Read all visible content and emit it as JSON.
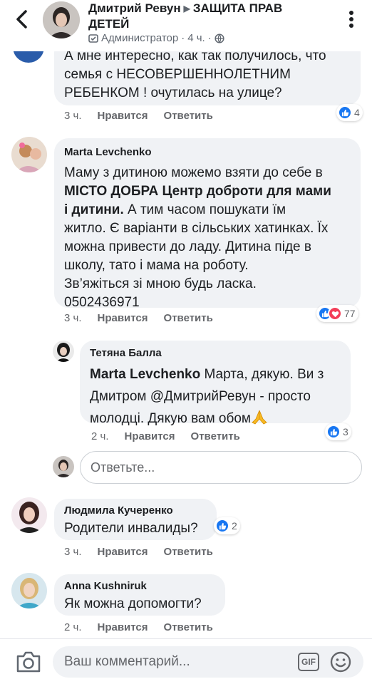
{
  "header": {
    "author": "Дмитрий Ревун",
    "group": "ЗАЩИТА ПРАВ ДЕТЕЙ",
    "role": "Администратор",
    "time": "4 ч.",
    "dot": "·"
  },
  "comments": [
    {
      "text_lines": [
        "А мне интересно, как так получилось, что",
        "семья с НЕСОВЕРШЕННОЛЕТНИМ",
        "РЕБЕНКОМ ! очутилась на улице?"
      ],
      "time": "3 ч.",
      "like_label": "Нравится",
      "reply_label": "Ответить",
      "reaction_count": "4"
    },
    {
      "name": "Marta Levchenko",
      "text_lines": [
        "Маму з дитиною можемо взяти до себе в",
        "МІСТО ДОБРА Центр доброти для мами",
        "і дитини.",
        " А тим часом пошукати їм",
        "житло. Є варіанти в сільських хатинках. Їх",
        "можна привести до ладу. Дитина піде в",
        "школу, тато і мама на роботу.",
        "Зв’яжіться зі мною будь ласка.",
        "0502436971"
      ],
      "time": "3 ч.",
      "like_label": "Нравится",
      "reply_label": "Ответить",
      "reaction_count": "77"
    },
    {
      "name": "Тетяна Балла",
      "mention": "Marta Levchenko",
      "text_lines": [
        " Марта, дякую. Ви з",
        "Дмитром @ДмитрийРевун - просто",
        "молодці. Дякую вам обом"
      ],
      "time": "2 ч.",
      "like_label": "Нравится",
      "reply_label": "Ответить",
      "reaction_count": "3"
    },
    {
      "name": "Людмила Кучеренко",
      "text_lines": [
        "Родители инвалиды?"
      ],
      "time": "3 ч.",
      "like_label": "Нравится",
      "reply_label": "Ответить",
      "reaction_count": "2"
    },
    {
      "name": "Anna Kushniruk",
      "text_lines": [
        "Як можна допомогти?"
      ],
      "time": "2 ч.",
      "like_label": "Нравится",
      "reply_label": "Ответить"
    }
  ],
  "reply_input": {
    "placeholder": "Ответьте..."
  },
  "compose": {
    "placeholder": "Ваш комментарий...",
    "gif_label": "GIF"
  },
  "colors": {
    "like": "#1877f2",
    "love": "#f33e58",
    "bubble": "#f0f2f5",
    "meta": "#65676b"
  }
}
